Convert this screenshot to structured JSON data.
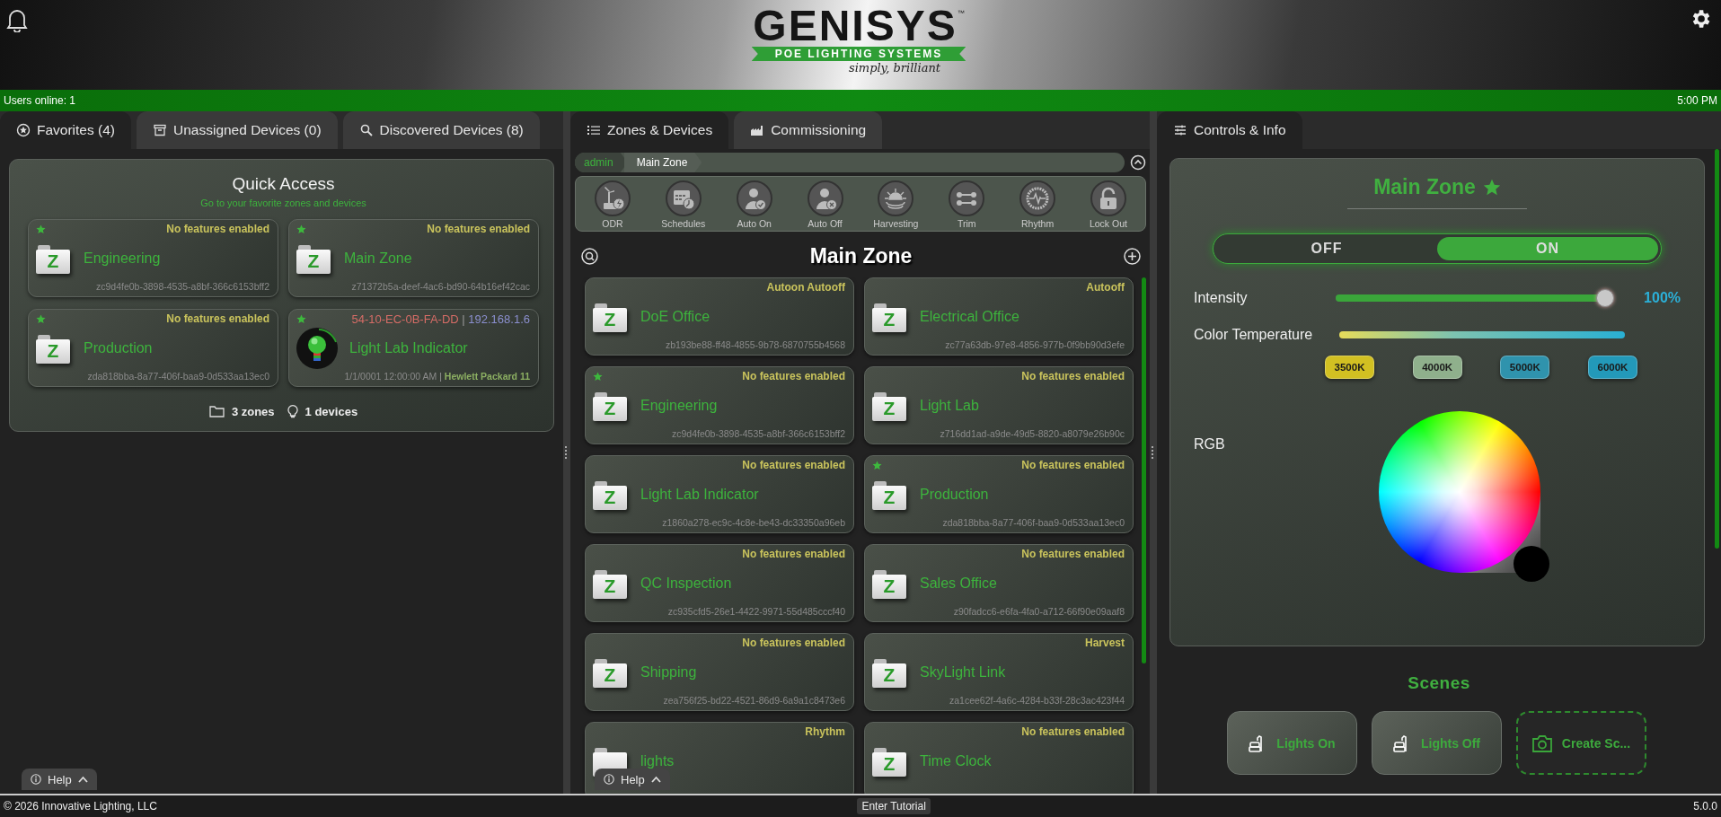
{
  "header": {
    "brand": "GENISYS",
    "trademark": "™",
    "tagline": "POE LIGHTING SYSTEMS",
    "slogan": "simply, brilliant"
  },
  "status_bar": {
    "users_online": "Users online: 1",
    "time": "5:00 PM"
  },
  "left_panel": {
    "tabs": [
      {
        "label": "Favorites (4)",
        "selected": true
      },
      {
        "label": "Unassigned Devices (0)",
        "selected": false
      },
      {
        "label": "Discovered Devices (8)",
        "selected": false
      }
    ],
    "title": "Quick Access",
    "subtitle": "Go to your favorite zones and devices",
    "cards": [
      {
        "kind": "zone",
        "favorite": true,
        "features": "No features enabled",
        "icon_letter": "Z",
        "name": "Engineering",
        "id": "zc9d4fe0b-3898-4535-a8bf-366c6153bff2"
      },
      {
        "kind": "zone",
        "favorite": true,
        "features": "No features enabled",
        "icon_letter": "Z",
        "name": "Main Zone",
        "id": "z71372b5a-deef-4ac6-bd90-64b16ef42cac"
      },
      {
        "kind": "zone",
        "favorite": true,
        "features": "No features enabled",
        "icon_letter": "Z",
        "name": "Production",
        "id": "zda818bba-8a77-406f-baa9-0d533aa13ec0"
      },
      {
        "kind": "device",
        "favorite": true,
        "mac": "54-10-EC-0B-FA-DD",
        "separator": "|",
        "ip": "192.168.1.6",
        "name": "Light Lab Indicator",
        "date": "1/1/0001 12:00:00 AM",
        "model": "Hewlett Packard 11"
      }
    ],
    "summary": {
      "zones": "3 zones",
      "devices": "1 devices"
    },
    "help": "Help"
  },
  "middle_panel": {
    "tabs": [
      {
        "label": "Zones & Devices",
        "selected": true
      },
      {
        "label": "Commissioning",
        "selected": false
      }
    ],
    "breadcrumb": [
      "admin",
      "Main Zone"
    ],
    "features": [
      "ODR",
      "Schedules",
      "Auto On",
      "Auto Off",
      "Harvesting",
      "Trim",
      "Rhythm",
      "Lock Out"
    ],
    "title": "Main Zone",
    "cards": [
      {
        "kind": "zone",
        "favorite": false,
        "features": "Autoon Autooff",
        "icon_letter": "Z",
        "name": "DoE Office",
        "id": "zb193be88-ff48-4855-9b78-6870755b4568"
      },
      {
        "kind": "zone",
        "favorite": false,
        "features": "Autooff",
        "icon_letter": "Z",
        "name": "Electrical Office",
        "id": "zc77a63db-97e8-4856-977b-0f9bb90d3efe"
      },
      {
        "kind": "zone",
        "favorite": true,
        "features": "No features enabled",
        "icon_letter": "Z",
        "name": "Engineering",
        "id": "zc9d4fe0b-3898-4535-a8bf-366c6153bff2"
      },
      {
        "kind": "zone",
        "favorite": false,
        "features": "No features enabled",
        "icon_letter": "Z",
        "name": "Light Lab",
        "id": "z716dd1ad-a9de-49d5-8820-a8079e26b90c"
      },
      {
        "kind": "zone",
        "favorite": false,
        "features": "No features enabled",
        "icon_letter": "Z",
        "name": "Light Lab Indicator",
        "id": "z1860a278-ec9c-4c8e-be43-dc33350a96eb"
      },
      {
        "kind": "zone",
        "favorite": true,
        "features": "No features enabled",
        "icon_letter": "Z",
        "name": "Production",
        "id": "zda818bba-8a77-406f-baa9-0d533aa13ec0"
      },
      {
        "kind": "zone",
        "favorite": false,
        "features": "No features enabled",
        "icon_letter": "Z",
        "name": "QC Inspection",
        "id": "zc935cfd5-26e1-4422-9971-55d485cccf40"
      },
      {
        "kind": "zone",
        "favorite": false,
        "features": "No features enabled",
        "icon_letter": "Z",
        "name": "Sales Office",
        "id": "z90fadcc6-e6fa-4fa0-a712-66f90e09aaf8"
      },
      {
        "kind": "zone",
        "favorite": false,
        "features": "No features enabled",
        "icon_letter": "Z",
        "name": "Shipping",
        "id": "zea756f25-bd22-4521-86d9-6a9a1c8473e6"
      },
      {
        "kind": "zone",
        "favorite": false,
        "features": "Harvest",
        "icon_letter": "Z",
        "name": "SkyLight Link",
        "id": "za1cee62f-4a6c-4284-b33f-28c3ac423f44"
      },
      {
        "kind": "zone",
        "favorite": false,
        "features": "Rhythm",
        "name": "lights"
      },
      {
        "kind": "zone",
        "favorite": false,
        "features": "No features enabled",
        "icon_letter": "Z",
        "name": "Time Clock"
      }
    ],
    "help": "Help"
  },
  "right_panel": {
    "tabs": [
      {
        "label": "Controls & Info",
        "selected": true
      }
    ],
    "title": "Main Zone",
    "favorite": true,
    "power": [
      {
        "label": "OFF",
        "selected": false
      },
      {
        "label": "ON",
        "selected": true
      }
    ],
    "intensity": {
      "label": "Intensity",
      "level": 1,
      "reading": "100%"
    },
    "color_temperature": {
      "label": "Color Temperature",
      "presets": [
        {
          "label": "3500K",
          "color": "#d2c022"
        },
        {
          "label": "4000K",
          "color": "#8fb08c"
        },
        {
          "label": "5000K",
          "color": "#2f93ad"
        },
        {
          "label": "6000K",
          "color": "#2399b9"
        }
      ]
    },
    "rgb": {
      "label": "RGB"
    },
    "scenes": {
      "title": "Scenes",
      "buttons": [
        {
          "kind": "scene",
          "label": "Lights On"
        },
        {
          "kind": "scene",
          "label": "Lights Off"
        },
        {
          "kind": "create",
          "label": "Create Sc..."
        }
      ]
    }
  },
  "footer": {
    "copyright": "© 2026 Innovative Lighting, LLC",
    "tutorial": "Enter Tutorial",
    "version": "5.0.0"
  }
}
